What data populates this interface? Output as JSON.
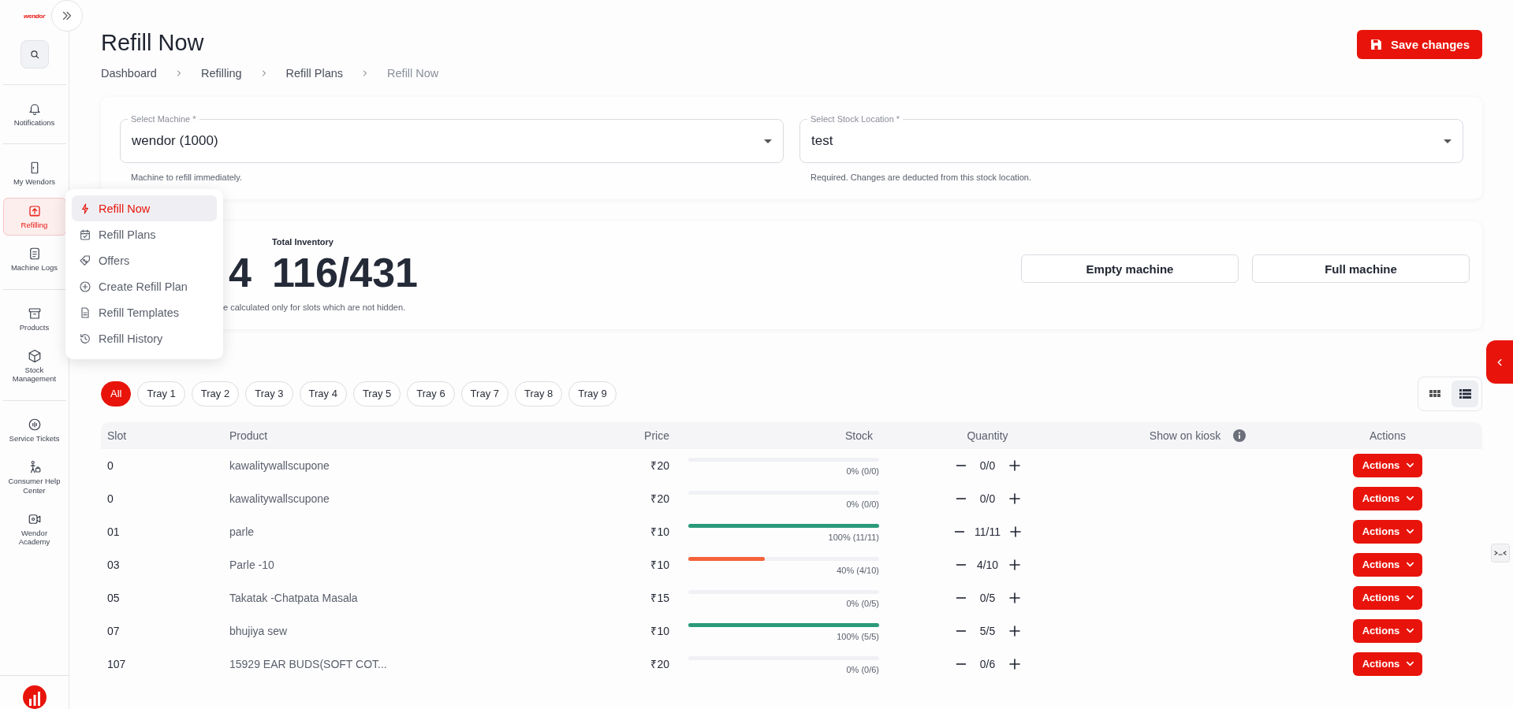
{
  "logo": {
    "text": "wendor"
  },
  "sidebar": {
    "groups": [
      [
        {
          "label": "Notifications",
          "selected": false
        }
      ],
      [
        {
          "label": "My Wendors",
          "selected": false
        },
        {
          "label": "Refilling",
          "selected": true
        },
        {
          "label": "Machine Logs",
          "selected": false
        }
      ],
      [
        {
          "label": "Products",
          "selected": false
        },
        {
          "label": "Stock Management",
          "selected": false
        }
      ],
      [
        {
          "label": "Service Tickets",
          "selected": false
        },
        {
          "label": "Consumer Help Center",
          "selected": false
        },
        {
          "label": "Wendor Academy",
          "selected": false
        }
      ]
    ]
  },
  "flyout_menu": {
    "items": [
      {
        "label": "Refill Now",
        "selected": true
      },
      {
        "label": "Refill Plans",
        "selected": false
      },
      {
        "label": "Offers",
        "selected": false
      },
      {
        "label": "Create Refill Plan",
        "selected": false
      },
      {
        "label": "Refill Templates",
        "selected": false
      },
      {
        "label": "Refill History",
        "selected": false
      }
    ]
  },
  "header": {
    "title": "Refill Now",
    "breadcrumb": [
      "Dashboard",
      "Refilling",
      "Refill Plans",
      "Refill Now"
    ],
    "save_button": "Save changes"
  },
  "filters": [
    {
      "label": "Select Machine *",
      "value": "wendor (1000)",
      "helper": "Machine to refill immediately."
    },
    {
      "label": "Select Stock Location *",
      "value": "test",
      "helper": "Required. Changes are deducted from this stock location."
    }
  ],
  "stats": {
    "items": [
      {
        "value": "4"
      },
      {
        "label": "Total Inventory",
        "value": "116/431"
      }
    ],
    "note": "e calculated only for slots which are not hidden.",
    "buttons": [
      "Empty machine",
      "Full machine"
    ]
  },
  "trays": [
    {
      "label": "All",
      "selected": true
    },
    {
      "label": "Tray 1",
      "selected": false
    },
    {
      "label": "Tray 2",
      "selected": false
    },
    {
      "label": "Tray 3",
      "selected": false
    },
    {
      "label": "Tray 4",
      "selected": false
    },
    {
      "label": "Tray 5",
      "selected": false
    },
    {
      "label": "Tray 6",
      "selected": false
    },
    {
      "label": "Tray 7",
      "selected": false
    },
    {
      "label": "Tray 8",
      "selected": false
    },
    {
      "label": "Tray 9",
      "selected": false
    }
  ],
  "view_toggle": [
    {
      "kind": "grid",
      "selected": false
    },
    {
      "kind": "list",
      "selected": true
    }
  ],
  "table": {
    "columns": [
      "Slot",
      "Product",
      "Price",
      "Stock",
      "Quantity",
      "Show on kiosk",
      "Actions"
    ],
    "rows": [
      {
        "slot": "0",
        "product": "kawalitywallscupone",
        "price": "₹20",
        "level": 0,
        "stock": "0% (0/0)",
        "quantity": "0/0",
        "action": "Actions"
      },
      {
        "slot": "0",
        "product": "kawalitywallscupone",
        "price": "₹20",
        "level": 0,
        "stock": "0% (0/0)",
        "quantity": "0/0",
        "action": "Actions"
      },
      {
        "slot": "01",
        "product": "parle",
        "price": "₹10",
        "level": 1,
        "stock": "100% (11/11)",
        "quantity": "11/11",
        "action": "Actions"
      },
      {
        "slot": "03",
        "product": "Parle -10",
        "price": "₹10",
        "level": 0.4,
        "stock": "40% (4/10)",
        "quantity": "4/10",
        "action": "Actions"
      },
      {
        "slot": "05",
        "product": "Takatak -Chatpata Masala",
        "price": "₹15",
        "level": 0,
        "stock": "0% (0/5)",
        "quantity": "0/5",
        "action": "Actions"
      },
      {
        "slot": "07",
        "product": "bhujiya sew",
        "price": "₹10",
        "level": 1,
        "stock": "100% (5/5)",
        "quantity": "5/5",
        "action": "Actions"
      },
      {
        "slot": "107",
        "product": "15929 EAR BUDS(SOFT COT...",
        "price": "₹20",
        "level": 0,
        "stock": "0% (0/6)",
        "quantity": "0/6",
        "action": "Actions"
      }
    ]
  }
}
